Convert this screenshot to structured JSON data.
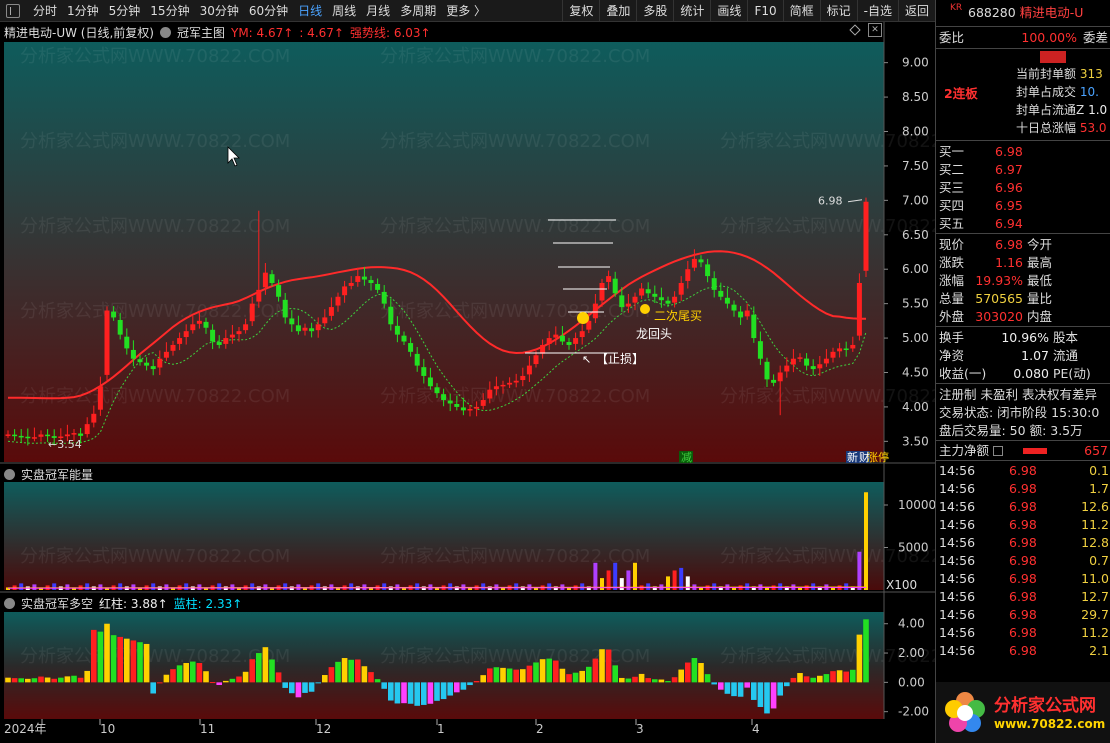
{
  "toolbar": {
    "periods": [
      "分时",
      "1分钟",
      "5分钟",
      "15分钟",
      "30分钟",
      "60分钟",
      "日线",
      "周线",
      "月线",
      "多周期",
      "更多 〉"
    ],
    "active_period": "日线",
    "tools": [
      "复权",
      "叠加",
      "多股",
      "统计",
      "画线",
      "F10",
      "简框",
      "标记",
      "-自选",
      "返回"
    ]
  },
  "main_pane": {
    "stock_label": "精进电动-UW (日线,前复权)",
    "indicator_name": "冠军主图",
    "ym_label": "YM: 4.67↑",
    "ym_extra": ": 4.67↑",
    "strength_label": "强势线: 6.03↑",
    "y_ticks": [
      "9.00",
      "8.50",
      "8.00",
      "7.50",
      "7.00",
      "6.50",
      "6.00",
      "5.50",
      "5.00",
      "4.50",
      "4.00",
      "3.50"
    ],
    "annotation_high": "6.98",
    "annotation_low": "3.54",
    "stop_loss_label": "【止损】",
    "second_tail_label": "二次尾买",
    "dragon_label": "龙回头",
    "marker_reduce": "减",
    "marker_new": "新",
    "marker_finance": "财",
    "marker_limit": "涨停",
    "watermark": "分析家公式网WWW.70822.COM"
  },
  "volume_pane": {
    "title": "实盘冠军能量",
    "y_ticks": [
      "10000",
      "5000"
    ],
    "unit": "X100"
  },
  "ls_pane": {
    "title": "实盘冠军多空",
    "red_label": "红柱: 3.88↑",
    "blue_label": "蓝柱: 2.33↑",
    "y_ticks": [
      "4.00",
      "2.00",
      "0.00",
      "-2.00"
    ]
  },
  "x_axis": {
    "labels": [
      "2024年",
      "10",
      "11",
      "12",
      "1",
      "2",
      "3",
      "4"
    ]
  },
  "chart_data": {
    "type": "candlestick",
    "ylim": [
      3.2,
      9.3
    ],
    "closes": [
      3.6,
      3.58,
      3.57,
      3.55,
      3.56,
      3.6,
      3.58,
      3.55,
      3.57,
      3.6,
      3.62,
      3.58,
      3.75,
      3.9,
      4.3,
      5.4,
      5.3,
      5.05,
      4.85,
      4.7,
      4.65,
      4.6,
      4.55,
      4.7,
      4.8,
      4.9,
      5.0,
      5.1,
      5.2,
      5.25,
      5.15,
      4.95,
      4.9,
      5.0,
      5.05,
      5.1,
      5.2,
      5.5,
      5.7,
      5.95,
      5.8,
      5.6,
      5.3,
      5.2,
      5.1,
      5.15,
      5.1,
      5.2,
      5.3,
      5.45,
      5.6,
      5.75,
      5.8,
      5.9,
      5.85,
      5.8,
      5.7,
      5.5,
      5.2,
      5.05,
      4.95,
      4.8,
      4.6,
      4.45,
      4.3,
      4.2,
      4.1,
      4.05,
      4.0,
      3.95,
      3.97,
      4.0,
      4.1,
      4.25,
      4.3,
      4.32,
      4.35,
      4.38,
      4.45,
      4.6,
      4.75,
      4.9,
      5.0,
      5.05,
      4.95,
      4.9,
      5.0,
      5.1,
      5.25,
      5.5,
      5.8,
      5.9,
      5.65,
      5.45,
      5.5,
      5.6,
      5.72,
      5.65,
      5.6,
      5.55,
      5.5,
      5.6,
      5.8,
      6.0,
      6.15,
      6.1,
      5.9,
      5.7,
      5.6,
      5.5,
      5.4,
      5.3,
      5.4,
      5.0,
      4.7,
      4.4,
      4.35,
      4.5,
      4.6,
      4.7,
      4.72,
      4.6,
      4.55,
      4.62,
      4.7,
      4.8,
      4.85,
      4.84,
      4.9,
      5.8,
      6.98
    ]
  }
}
